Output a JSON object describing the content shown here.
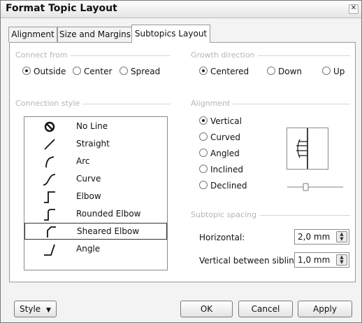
{
  "window": {
    "title": "Format Topic Layout",
    "close_glyph": "✕"
  },
  "tabs": [
    {
      "label": "Alignment"
    },
    {
      "label": "Size and Margins"
    },
    {
      "label": "Subtopics Layout"
    }
  ],
  "connect_from": {
    "heading": "Connect from",
    "options": [
      {
        "label": "Outside",
        "checked": true
      },
      {
        "label": "Center",
        "checked": false
      },
      {
        "label": "Spread",
        "checked": false
      }
    ]
  },
  "growth_direction": {
    "heading": "Growth direction",
    "options": [
      {
        "label": "Centered",
        "checked": true
      },
      {
        "label": "Down",
        "checked": false
      },
      {
        "label": "Up",
        "checked": false
      }
    ]
  },
  "connection_style": {
    "heading": "Connection style",
    "selected": "Sheared Elbow",
    "items": [
      {
        "label": "No Line",
        "icon": "no-line-icon"
      },
      {
        "label": "Straight",
        "icon": "straight-line-icon"
      },
      {
        "label": "Arc",
        "icon": "arc-line-icon"
      },
      {
        "label": "Curve",
        "icon": "curve-line-icon"
      },
      {
        "label": "Elbow",
        "icon": "elbow-line-icon"
      },
      {
        "label": "Rounded Elbow",
        "icon": "rounded-elbow-line-icon"
      },
      {
        "label": "Sheared Elbow",
        "icon": "sheared-elbow-line-icon"
      },
      {
        "label": "Angle",
        "icon": "angle-line-icon"
      }
    ]
  },
  "alignment": {
    "heading": "Alignment",
    "options": [
      {
        "label": "Vertical",
        "checked": true
      },
      {
        "label": "Curved",
        "checked": false
      },
      {
        "label": "Angled",
        "checked": false
      },
      {
        "label": "Inclined",
        "checked": false
      },
      {
        "label": "Declined",
        "checked": false
      }
    ]
  },
  "subtopic_spacing": {
    "heading": "Subtopic spacing",
    "horizontal_label": "Horizontal:",
    "horizontal_value": "2,0 mm",
    "vertical_label": "Vertical between siblings:",
    "vertical_value": "1,0 mm"
  },
  "footer": {
    "style_label": "Style",
    "style_arrow": "▼",
    "ok_label": "OK",
    "cancel_label": "Cancel",
    "apply_label": "Apply"
  }
}
